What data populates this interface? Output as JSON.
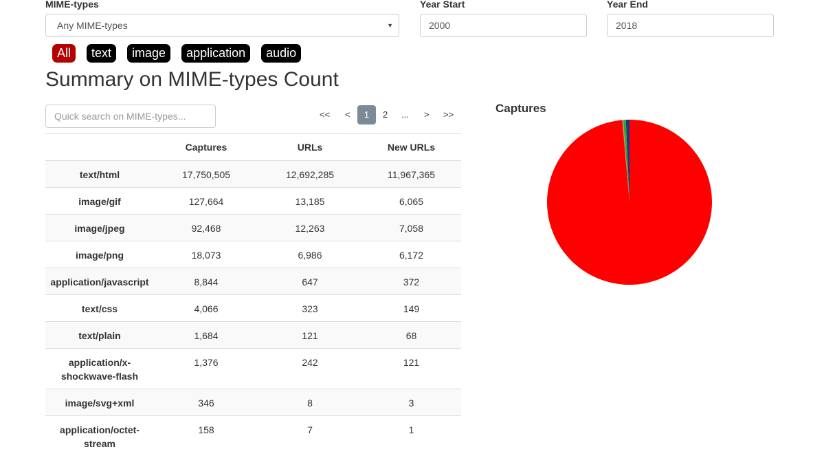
{
  "filters_bar": {
    "mime_label": "MIME-types",
    "mime_selected": "Any MIME-types",
    "year_start_label": "Year Start",
    "year_start_value": "2000",
    "year_end_label": "Year End",
    "year_end_value": "2018"
  },
  "type_filters": [
    "All",
    "text",
    "image",
    "application",
    "audio"
  ],
  "active_type_filter": "All",
  "summary": {
    "heading": "Summary on MIME-types Count",
    "search_placeholder": "Quick search on MIME-types..."
  },
  "pagination": {
    "first": "<<",
    "prev": "<",
    "current": "1",
    "next_page": "2",
    "ellipsis": "...",
    "next": ">",
    "last": ">>"
  },
  "table": {
    "columns": [
      "",
      "Captures",
      "URLs",
      "New URLs"
    ],
    "rows": [
      {
        "mime": "text/html",
        "captures": "17,750,505",
        "urls": "12,692,285",
        "new_urls": "11,967,365"
      },
      {
        "mime": "image/gif",
        "captures": "127,664",
        "urls": "13,185",
        "new_urls": "6,065"
      },
      {
        "mime": "image/jpeg",
        "captures": "92,468",
        "urls": "12,263",
        "new_urls": "7,058"
      },
      {
        "mime": "image/png",
        "captures": "18,073",
        "urls": "6,986",
        "new_urls": "6,172"
      },
      {
        "mime": "application/javascript",
        "captures": "8,844",
        "urls": "647",
        "new_urls": "372"
      },
      {
        "mime": "text/css",
        "captures": "4,066",
        "urls": "323",
        "new_urls": "149"
      },
      {
        "mime": "text/plain",
        "captures": "1,684",
        "urls": "121",
        "new_urls": "68"
      },
      {
        "mime": "application/x-shockwave-flash",
        "captures": "1,376",
        "urls": "242",
        "new_urls": "121"
      },
      {
        "mime": "image/svg+xml",
        "captures": "346",
        "urls": "8",
        "new_urls": "3"
      },
      {
        "mime": "application/octet-stream",
        "captures": "158",
        "urls": "7",
        "new_urls": "1"
      }
    ]
  },
  "chart_data": {
    "type": "pie",
    "title": "Captures",
    "categories": [
      "text/html",
      "image/gif",
      "image/jpeg",
      "image/png",
      "application/javascript",
      "text/css",
      "text/plain",
      "application/x-shockwave-flash",
      "image/svg+xml",
      "application/octet-stream"
    ],
    "values": [
      17750505,
      127664,
      92468,
      18073,
      8844,
      4066,
      1684,
      1376,
      346,
      158
    ],
    "colors": [
      "#ff0000",
      "#1f2f8f",
      "#22aa22",
      "#e8a020",
      "#8a2be2",
      "#00b3b3",
      "#ff66cc",
      "#996633",
      "#666666",
      "#cccc00"
    ],
    "legend": "none"
  }
}
